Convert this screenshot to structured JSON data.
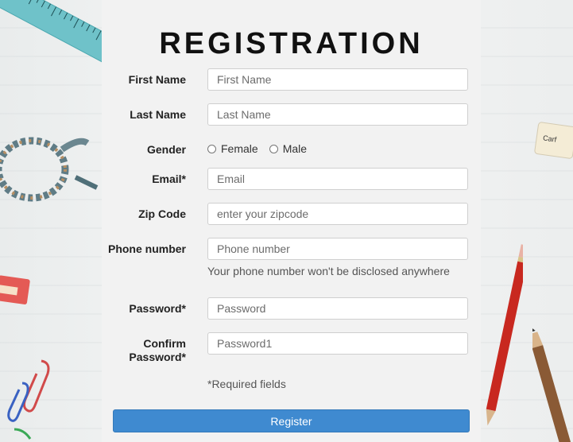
{
  "form": {
    "title": "REGISTRATION",
    "first_name": {
      "label": "First Name",
      "placeholder": "First Name",
      "value": ""
    },
    "last_name": {
      "label": "Last Name",
      "placeholder": "Last Name",
      "value": ""
    },
    "gender": {
      "label": "Gender",
      "options": [
        "Female",
        "Male"
      ],
      "selected": null
    },
    "email": {
      "label": "Email*",
      "placeholder": "Email",
      "value": ""
    },
    "zip": {
      "label": "Zip Code",
      "placeholder": "enter your zipcode",
      "value": ""
    },
    "phone": {
      "label": "Phone number",
      "placeholder": "Phone number",
      "value": "",
      "hint": "Your phone number won't be disclosed anywhere"
    },
    "password": {
      "label": "Password*",
      "placeholder": "Password",
      "value": ""
    },
    "confirm_password": {
      "label_line1": "Confirm",
      "label_line2": "Password*",
      "placeholder": "Password1",
      "value": ""
    },
    "required_note": "*Required fields",
    "submit_label": "Register"
  },
  "theme": {
    "accent": "#3f8ad0",
    "panel_bg": "#f2f2f2"
  },
  "decorations": [
    "ruler",
    "glasses",
    "eraser",
    "paper-clips",
    "pencil",
    "pen",
    "eraser-small"
  ]
}
